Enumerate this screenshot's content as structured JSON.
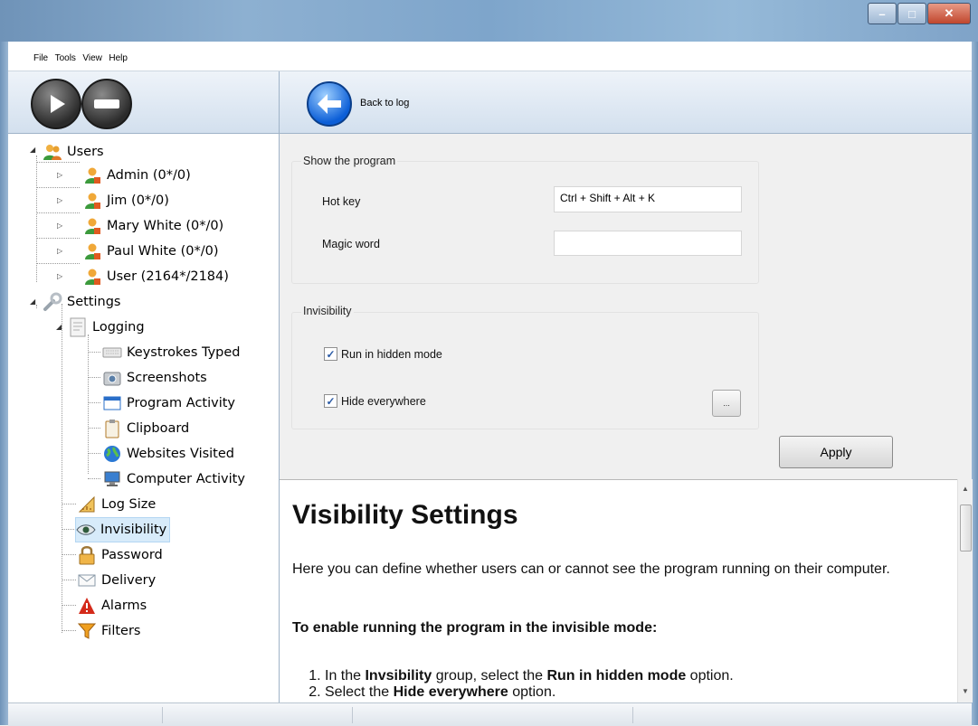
{
  "menu": [
    "File",
    "Tools",
    "View",
    "Help"
  ],
  "window_controls": {
    "minimize": "–",
    "maximize": "□",
    "close": "✕"
  },
  "toolbar": {
    "back_label": "Back to log"
  },
  "tree": {
    "users": {
      "label": "Users",
      "items": [
        "Admin (0*/0)",
        "Jim (0*/0)",
        "Mary White (0*/0)",
        "Paul White (0*/0)",
        "User (2164*/2184)"
      ]
    },
    "settings": {
      "label": "Settings",
      "logging": {
        "label": "Logging",
        "items": [
          "Keystrokes Typed",
          "Screenshots",
          "Program Activity",
          "Clipboard",
          "Websites Visited",
          "Computer Activity"
        ]
      },
      "items": [
        "Log Size",
        "Invisibility",
        "Password",
        "Delivery",
        "Alarms",
        "Filters"
      ],
      "selected": "Invisibility"
    }
  },
  "show_program": {
    "title": "Show the program",
    "hotkey_label": "Hot key",
    "hotkey_value": "Ctrl + Shift + Alt + K",
    "magic_label": "Magic word",
    "magic_value": ""
  },
  "invisibility": {
    "title": "Invisibility",
    "run_hidden_label": "Run in hidden mode",
    "run_hidden_checked": true,
    "hide_everywhere_label": "Hide everywhere",
    "hide_everywhere_checked": true,
    "ellipsis_label": "..."
  },
  "apply_label": "Apply",
  "help": {
    "title": "Visibility Settings",
    "intro": "Here you can define whether users can or cannot see the program running on their computer.",
    "heading": "To enable running the program in the invisible mode:",
    "step1": {
      "pre": "In the ",
      "b1": "Invsibility",
      "mid": " group, select the ",
      "b2": "Run in hidden mode",
      "post": " option."
    },
    "step2": {
      "pre": "Select the ",
      "b1": "Hide everywhere",
      "post": " option."
    }
  }
}
